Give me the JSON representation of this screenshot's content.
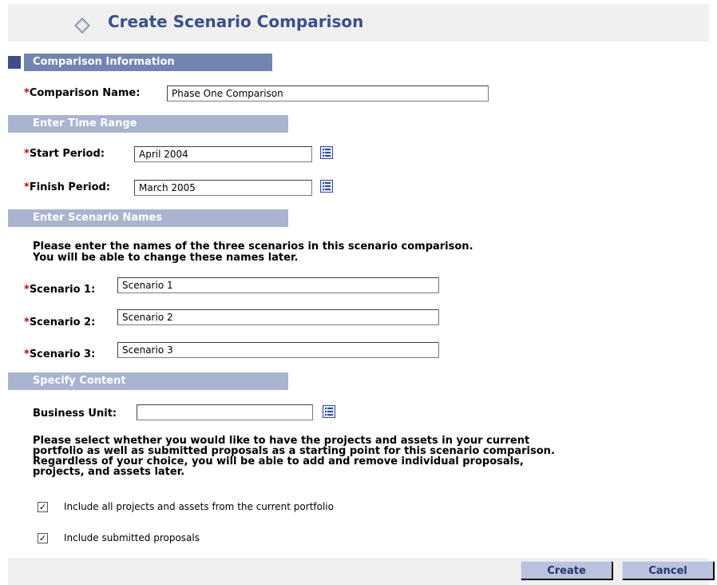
{
  "page": {
    "title": "Create Scenario Comparison"
  },
  "sections": {
    "comparison_info": "Comparison Information",
    "time_range": "Enter Time Range",
    "scenario_names": "Enter Scenario Names",
    "specify_content": "Specify Content"
  },
  "required_marker": "*",
  "comparison": {
    "name_label": "Comparison Name:",
    "name_value": "Phase One Comparison"
  },
  "time_range": {
    "start_label": "Start Period:",
    "start_value": "April 2004",
    "finish_label": "Finish Period:",
    "finish_value": "March 2005"
  },
  "scenarios": {
    "instructions_line1": "Please enter the names of the three scenarios in this scenario comparison.",
    "instructions_line2": "You will be able to change these names later.",
    "items": [
      {
        "label": "Scenario 1:",
        "value": "Scenario 1"
      },
      {
        "label": "Scenario 2:",
        "value": "Scenario 2"
      },
      {
        "label": "Scenario 3:",
        "value": "Scenario 3"
      }
    ]
  },
  "content": {
    "business_unit_label": "Business Unit:",
    "business_unit_value": "",
    "instructions_lines": [
      "Please select whether you would like to have the projects and assets in your current",
      "portfolio as well as submitted proposals as a starting point for this scenario comparison.",
      "Regardless of your choice, you will be able to add and remove individual proposals,",
      "projects, and assets later."
    ],
    "checkboxes": [
      {
        "label": "Include all projects and assets from the current portfolio",
        "checked": true,
        "mark": "✓"
      },
      {
        "label": "Include submitted proposals",
        "checked": true,
        "mark": "✓"
      }
    ]
  },
  "buttons": {
    "create": "Create",
    "cancel": "Cancel"
  },
  "colors": {
    "title": "#3b4f8c",
    "section_dark": "#7384b0",
    "section_light": "#a9b4d0",
    "required": "#d40000",
    "button": "#b9c3dd"
  },
  "icons": {
    "title": "diamond-icon",
    "picker": "list-picker-icon",
    "check": "checkmark-icon"
  }
}
